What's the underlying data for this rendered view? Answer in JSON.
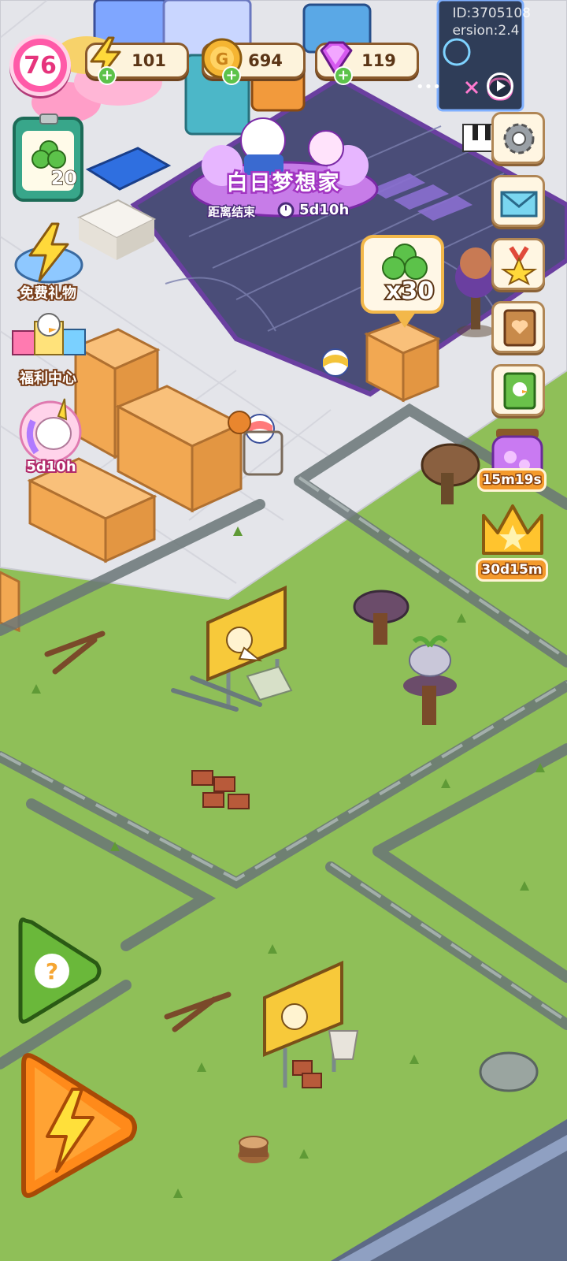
{
  "hud": {
    "level": "76",
    "energy": {
      "value": "101",
      "icon": "lightning-icon"
    },
    "coins": {
      "value": "694",
      "icon": "coin-icon"
    },
    "gems": {
      "value": "119",
      "icon": "gem-icon"
    },
    "debug_id": "ID:3705108",
    "debug_version": "ersion:2.4"
  },
  "left_panel": {
    "task_count": "20",
    "free_gift_label": "免费礼物",
    "welfare_label": "福利中心",
    "unicorn_event_timer": "5d10h"
  },
  "event_banner": {
    "title": "白日梦想家",
    "ends_label": "距离结束",
    "time_left": "5d10h"
  },
  "reward_bubble": {
    "quantity": "x30",
    "icon": "clover-icon"
  },
  "right_panel": {
    "settings": "gear-icon",
    "mail": "mail-icon",
    "achievements": "medal-icon",
    "album": "heart-book-icon",
    "diary": "green-book-icon",
    "jar_timer": "15m19s",
    "crown_timer": "30d15m"
  },
  "bottom_actions": {
    "help": "question-icon",
    "energy": "lightning-icon"
  },
  "colors": {
    "grass": "#8fbf58",
    "road": "#5f6a6c",
    "floor": "#e6e6ec",
    "court": "#4b4e7a",
    "accent_orange": "#f49a2c",
    "accent_pink": "#ff5aa8",
    "hud_border": "#8a5a2c"
  }
}
